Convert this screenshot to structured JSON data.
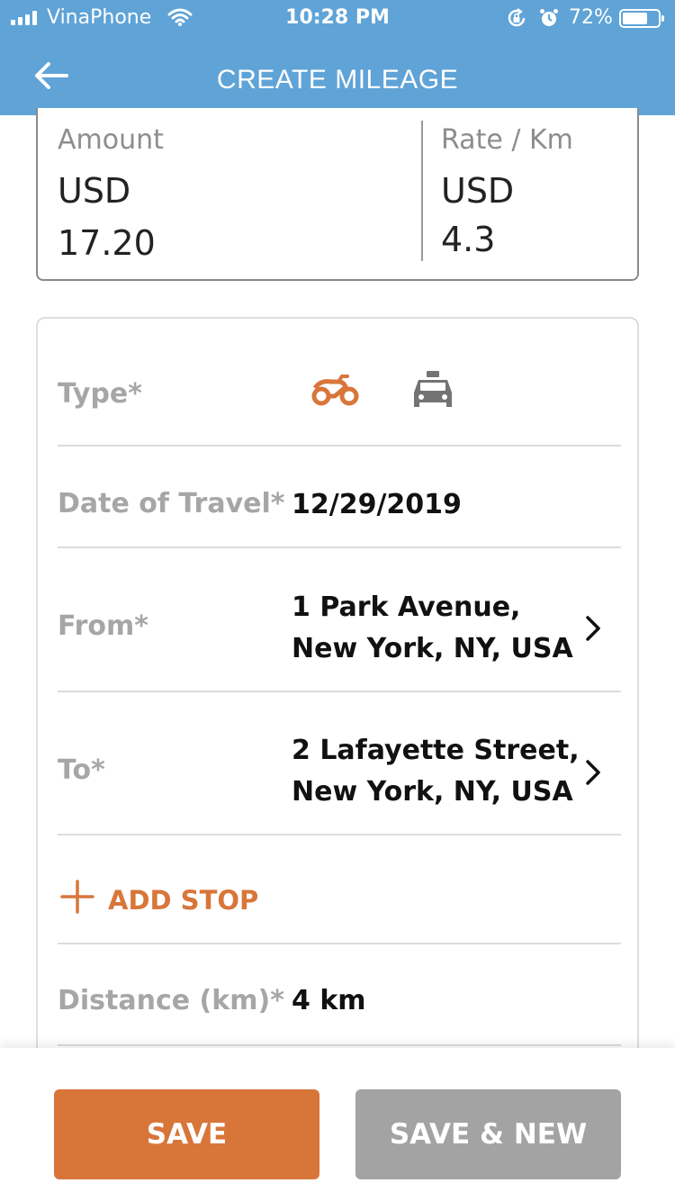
{
  "status_bar": {
    "carrier": "VinaPhone",
    "time": "10:28 PM",
    "battery_percent": "72%",
    "battery_level": 0.72,
    "icons": [
      "signal-icon",
      "wifi-icon",
      "rotation-lock-icon",
      "alarm-icon",
      "battery-icon"
    ]
  },
  "nav": {
    "title": "CREATE MILEAGE",
    "back_icon": "back-arrow-icon"
  },
  "summary": {
    "amount_label": "Amount",
    "amount_currency": "USD",
    "amount_value": "17.20",
    "rate_label": "Rate / Km",
    "rate_currency": "USD",
    "rate_value": "4.3"
  },
  "form": {
    "type_label": "Type*",
    "type_options": [
      {
        "name": "motorbike-icon",
        "selected": true
      },
      {
        "name": "car-icon",
        "selected": false
      }
    ],
    "date_label": "Date of Travel*",
    "date_value": "12/29/2019",
    "from_label": "From*",
    "from_line1": "1 Park Avenue,",
    "from_line2": "New York, NY, USA",
    "to_label": "To*",
    "to_line1": "2 Lafayette Street,",
    "to_line2": "New York, NY, USA",
    "add_stop_label": "ADD STOP",
    "distance_label": "Distance (km)*",
    "distance_value": "4 km"
  },
  "actions": {
    "save_label": "SAVE",
    "save_new_label": "SAVE & NEW"
  },
  "colors": {
    "header": "#5fa3d7",
    "accent": "#d8763a",
    "secondary_button": "#a3a3a3",
    "label_gray": "#a6a6a6"
  }
}
